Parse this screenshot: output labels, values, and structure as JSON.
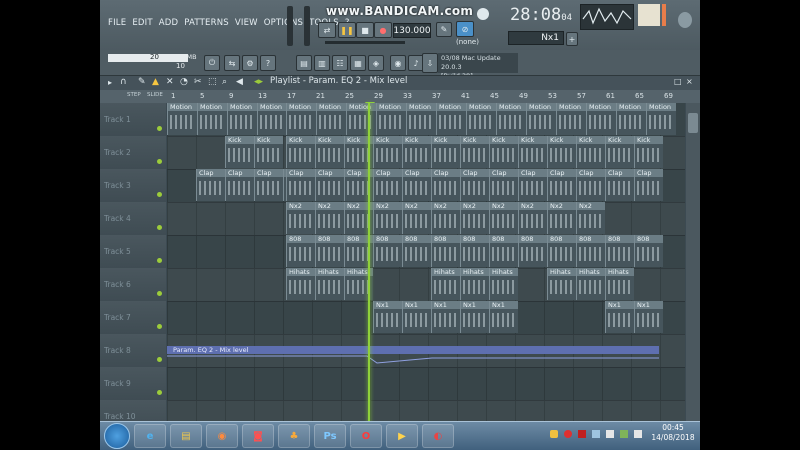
{
  "menu": [
    "FILE",
    "EDIT",
    "ADD",
    "PATTERNS",
    "VIEW",
    "OPTIONS",
    "TOOLS",
    "?"
  ],
  "watermark": "www.BANDICAM.com",
  "transport": {
    "clock": "28:08",
    "clock_sub": "04",
    "tempo": "130.000",
    "pattern_mode": "(none)",
    "pattern": "Nx1"
  },
  "memory": {
    "value1": "20",
    "value2": "10",
    "label": "480 MB"
  },
  "hint": {
    "line1": "03/08  Mac Update 20.0.3",
    "line2": "[Build 38]"
  },
  "playlist": {
    "title": "Playlist - Param. EQ 2 - Mix level",
    "snap": "STEP",
    "slide": "SLIDE"
  },
  "ruler": [
    "1",
    "5",
    "9",
    "13",
    "17",
    "21",
    "25",
    "29",
    "33",
    "37",
    "41",
    "45",
    "49",
    "53",
    "57",
    "61",
    "65",
    "69"
  ],
  "tracks": [
    {
      "name": "Track 1",
      "pattern": "Motion"
    },
    {
      "name": "Track 2",
      "pattern": "Kick"
    },
    {
      "name": "Track 3",
      "pattern": "Clap"
    },
    {
      "name": "Track 4",
      "pattern": "Nx2"
    },
    {
      "name": "Track 5",
      "pattern": "808"
    },
    {
      "name": "Track 6",
      "pattern": "Hihats"
    },
    {
      "name": "Track 7",
      "pattern": "Nx1"
    },
    {
      "name": "Track 8",
      "pattern": ""
    },
    {
      "name": "Track 9",
      "pattern": ""
    },
    {
      "name": "Track 10",
      "pattern": ""
    }
  ],
  "automation": {
    "label": "Param. EQ 2 - Mix level"
  },
  "taskbar": {
    "time": "00:45",
    "date": "14/08/2018"
  },
  "colors": {
    "playhead": "#8fd13a",
    "automation": "#5e6fb0",
    "accent": "#4a90c8"
  }
}
